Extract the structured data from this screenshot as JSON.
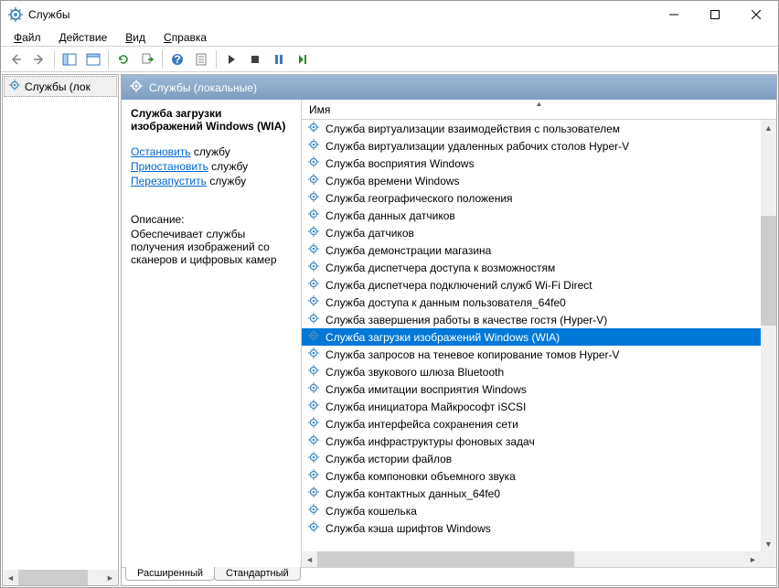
{
  "window": {
    "title": "Службы"
  },
  "menu": {
    "file": "Файл",
    "action": "Действие",
    "view": "Вид",
    "help": "Справка"
  },
  "tree": {
    "root": "Службы (лок"
  },
  "pane_title": "Службы (локальные)",
  "details": {
    "service_name": "Служба загрузки изображений Windows (WIA)",
    "stop": "Остановить",
    "stop_suffix": " службу",
    "pause": "Приостановить",
    "pause_suffix": " службу",
    "restart": "Перезапустить",
    "restart_suffix": " службу",
    "desc_label": "Описание:",
    "desc": "Обеспечивает службы получения изображений со сканеров и цифровых камер"
  },
  "column": "Имя",
  "services": [
    "Служба виртуализации взаимодействия с пользователем",
    "Служба виртуализации удаленных рабочих столов Hyper-V",
    "Служба восприятия Windows",
    "Служба времени Windows",
    "Служба географического положения",
    "Служба данных датчиков",
    "Служба датчиков",
    "Служба демонстрации магазина",
    "Служба диспетчера доступа к возможностям",
    "Служба диспетчера подключений служб Wi-Fi Direct",
    "Служба доступа к данным пользователя_64fe0",
    "Служба завершения работы в качестве гостя (Hyper-V)",
    "Служба загрузки изображений Windows (WIA)",
    "Служба запросов на теневое копирование томов Hyper-V",
    "Служба звукового шлюза Bluetooth",
    "Служба имитации восприятия Windows",
    "Служба инициатора Майкрософт iSCSI",
    "Служба интерфейса сохранения сети",
    "Служба инфраструктуры фоновых задач",
    "Служба истории файлов",
    "Служба компоновки объемного звука",
    "Служба контактных данных_64fe0",
    "Служба кошелька",
    "Служба кэша шрифтов Windows"
  ],
  "selected_index": 12,
  "tabs": {
    "extended": "Расширенный",
    "standard": "Стандартный"
  }
}
